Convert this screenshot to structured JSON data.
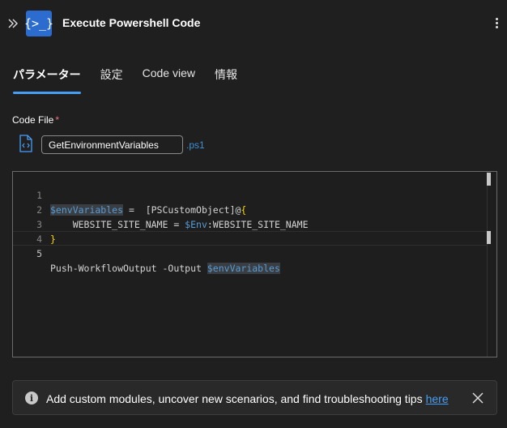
{
  "header": {
    "title": "Execute Powershell Code",
    "app_icon_text": "{>_}",
    "collapse_icon": "double-chevron-right-icon",
    "more_icon": "more-vertical-icon"
  },
  "tabs": [
    {
      "label": "パラメーター",
      "active": true
    },
    {
      "label": "設定",
      "active": false
    },
    {
      "label": "Code view",
      "active": false
    },
    {
      "label": "情報",
      "active": false
    }
  ],
  "code_file": {
    "label": "Code File",
    "required_mark": "*",
    "value": "GetEnvironmentVariables",
    "extension": ".ps1",
    "icon": "code-file-icon"
  },
  "editor": {
    "lines": [
      {
        "number": "1",
        "text": "$envVariables =  [PSCustomObject]@{"
      },
      {
        "number": "2",
        "text": "    WEBSITE_SITE_NAME = $Env:WEBSITE_SITE_NAME"
      },
      {
        "number": "3",
        "text": "}"
      },
      {
        "number": "4",
        "text": ""
      },
      {
        "number": "5",
        "text": "Push-WorkflowOutput -Output $envVariables"
      }
    ],
    "current_line": 5
  },
  "infobar": {
    "message": "Add custom modules, uncover new scenarios, and find troubleshooting tips",
    "link_text": "here",
    "info_icon": "info-icon",
    "close_icon": "close-icon"
  },
  "colors": {
    "accent": "#479ef5",
    "app_icon_bg": "#2c6ccf",
    "required": "#f1707b",
    "variable": "#569cd6",
    "brace": "#ffd700"
  }
}
